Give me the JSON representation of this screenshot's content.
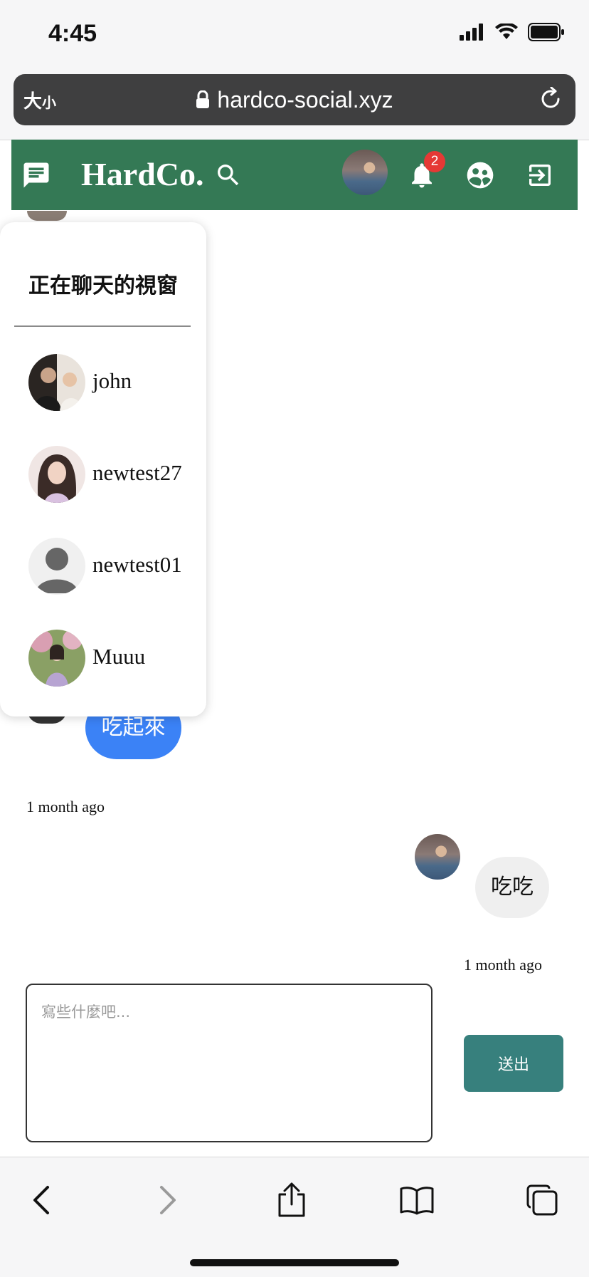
{
  "status_bar": {
    "time": "4:45"
  },
  "browser": {
    "text_size_label_big": "大",
    "text_size_label_small": "小",
    "url": "hardco-social.xyz"
  },
  "header": {
    "brand": "HardCo.",
    "notification_count": "2",
    "accent_color": "#347955"
  },
  "chat_list": {
    "title": "正在聊天的視窗",
    "items": [
      {
        "name": "john"
      },
      {
        "name": "newtest27"
      },
      {
        "name": "newtest01"
      },
      {
        "name": "Muuu"
      }
    ]
  },
  "conversation": {
    "messages": [
      {
        "text": "吃起來",
        "time": "1 month ago",
        "side": "left",
        "color": "#3b82f6"
      },
      {
        "text": "吃吃",
        "time": "1 month ago",
        "side": "right",
        "color": "#efefef"
      }
    ]
  },
  "composer": {
    "placeholder": "寫些什麼吧...",
    "send_label": "送出",
    "send_color": "#37807d"
  },
  "icons": [
    "signal-icon",
    "wifi-icon",
    "battery-icon",
    "lock-icon",
    "reload-icon",
    "chat-icon",
    "search-icon",
    "bell-icon",
    "friends-icon",
    "logout-icon",
    "back-icon",
    "forward-icon",
    "share-icon",
    "bookmarks-icon",
    "tabs-icon"
  ]
}
